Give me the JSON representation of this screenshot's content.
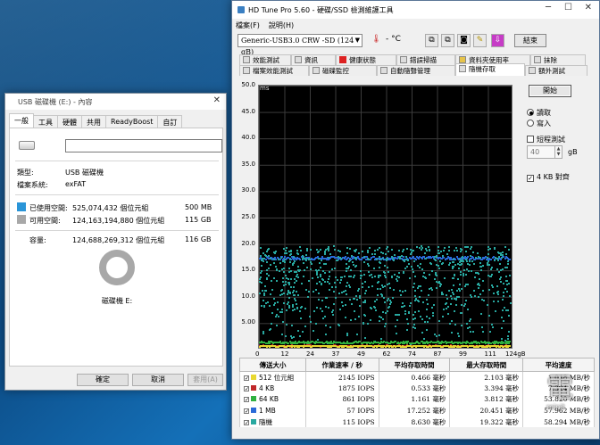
{
  "props_window": {
    "title": "USB 磁碟機 (E:) - 內容",
    "tabs": [
      "一般",
      "工具",
      "硬體",
      "共用",
      "ReadyBoost",
      "自訂"
    ],
    "type_label": "類型:",
    "type_value": "USB 磁碟機",
    "fs_label": "檔案系統:",
    "fs_value": "exFAT",
    "used_label": "已使用空間:",
    "used_bytes": "525,074,432 個位元組",
    "used_size": "500 MB",
    "free_label": "可用空間:",
    "free_bytes": "124,163,194,880 個位元組",
    "free_size": "115 GB",
    "cap_label": "容量:",
    "cap_bytes": "124,688,269,312 個位元組",
    "cap_size": "116 GB",
    "drive_caption": "磁碟機 E:",
    "ok": "確定",
    "cancel": "取消",
    "apply": "套用(A)",
    "colors": {
      "used": "#2a95d8",
      "free": "#a8a8a8"
    }
  },
  "hdtune": {
    "title": "HD Tune Pro 5.60 - 硬碟/SSD 檢測維護工具",
    "menu": [
      "檔案(F)",
      "說明(H)"
    ],
    "drive": "Generic-USB3.0 CRW   -SD (124 gB)",
    "temp": "- °C",
    "exit": "結束",
    "tabs_row1": [
      "效能測試",
      "資訊",
      "健康狀態",
      "錯誤掃描",
      "資料夾使用率",
      "抹除"
    ],
    "tabs_row2": [
      "檔案效能測試",
      "磁碟監控",
      "自動隨聲管理",
      "隨機存取",
      "額外測試"
    ],
    "start_btn": "開始",
    "read_label": "讀取",
    "write_label": "寫入",
    "short_test_label": "短程測試",
    "short_test_value": "40",
    "short_test_unit": "gB",
    "align_label": "4 KB 對齊",
    "y_unit": "ms",
    "y_ticks": [
      "50.0",
      "45.0",
      "40.0",
      "35.0",
      "30.0",
      "25.0",
      "20.0",
      "15.0",
      "10.0",
      "5.00",
      ""
    ],
    "x_ticks": [
      "0",
      "12",
      "24",
      "37",
      "49",
      "62",
      "74",
      "87",
      "99",
      "111",
      "124gB"
    ],
    "table": {
      "headers": [
        "傳送大小",
        "作業速率 / 秒",
        "平均存取時間",
        "最大存取時間",
        "平均速度"
      ],
      "rows": [
        {
          "name": "512 位元組",
          "color": "#e8d830",
          "iops": "2145 IOPS",
          "avg": "0.466 毫秒",
          "max": "2.103 毫秒",
          "speed": "1.048 MB/秒"
        },
        {
          "name": "4 KB",
          "color": "#c0282a",
          "iops": "1875 IOPS",
          "avg": "0.533 毫秒",
          "max": "3.394 毫秒",
          "speed": "7.324 MB/秒"
        },
        {
          "name": "64 KB",
          "color": "#30b040",
          "iops": "861 IOPS",
          "avg": "1.161 毫秒",
          "max": "3.812 毫秒",
          "speed": "53.820 MB/秒"
        },
        {
          "name": "1 MB",
          "color": "#2a6ad8",
          "iops": "57 IOPS",
          "avg": "17.252 毫秒",
          "max": "20.451 毫秒",
          "speed": "57.962 MB/秒"
        },
        {
          "name": "隨機",
          "color": "#28a8a0",
          "iops": "115 IOPS",
          "avg": "8.630 毫秒",
          "max": "19.322 毫秒",
          "speed": "58.294 MB/秒"
        }
      ]
    }
  },
  "chart_data": {
    "type": "scatter",
    "title": "",
    "xlabel": "",
    "ylabel": "ms",
    "xlim": [
      0,
      124
    ],
    "ylim": [
      0,
      50
    ],
    "grid": true,
    "series": [
      {
        "name": "1 MB",
        "color": "#2a6ad8",
        "y_mean": 17.25,
        "y_spread": 0.3
      },
      {
        "name": "隨機",
        "color": "#28a8a0",
        "y_min": 0.5,
        "y_max": 19.5
      },
      {
        "name": "64 KB",
        "color": "#30b040",
        "y_mean": 1.16,
        "y_spread": 0.2
      },
      {
        "name": "4 KB",
        "color": "#c0282a",
        "y_mean": 0.53,
        "y_spread": 0.1
      },
      {
        "name": "512 位元組",
        "color": "#e8d830",
        "y_mean": 0.47,
        "y_spread": 0.1
      }
    ]
  },
  "watermark": {
    "glyph": "電",
    "sub": "reinit"
  }
}
